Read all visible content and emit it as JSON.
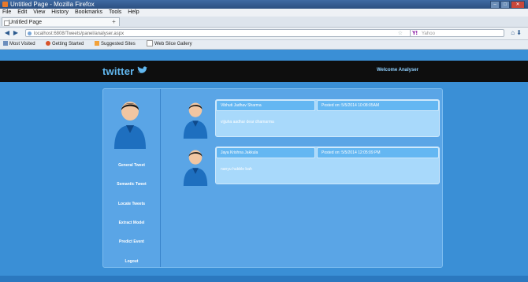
{
  "browser": {
    "window_title": "Untitled Page - Mozilla Firefox",
    "menu": [
      "File",
      "Edit",
      "View",
      "History",
      "Bookmarks",
      "Tools",
      "Help"
    ],
    "tab_title": "Untitled Page",
    "new_tab": "+",
    "url": "localhost:6808/Tweets/panel/analyser.aspx",
    "search_placeholder": "Yahoo",
    "bookmarks": [
      "Most Visited",
      "Getting Started",
      "Suggested Sites",
      "Web Slice Gallery"
    ]
  },
  "page": {
    "logo_text": "twitter",
    "welcome": "Welcome Analyser",
    "sidebar": [
      "General Tweet",
      "Semantic Tweet",
      "Locate Tweets",
      "Extract Model",
      "Predict Event",
      "Logout"
    ],
    "posts": [
      {
        "author": "Vibhuti Jadhav Sharma",
        "posted_on": "Posted on:  5/5/2014  10:08:05AM",
        "text": "vijjuha aadhar dear dhamarma"
      },
      {
        "author": "Jaya Krishna Jakkula",
        "posted_on": "Posted on:  5/5/2014  12:05:09 PM",
        "text": "nanyu hubble bah"
      }
    ]
  },
  "colors": {
    "page_bg": "#3a8fd6",
    "topbar": "#0e0e0e",
    "logo": "#62b8f0",
    "card": "#a8d9fb",
    "card_header": "#64b7f2"
  },
  "icons": {
    "bird": "twitter-bird-icon",
    "avatar": "user-avatar-icon"
  }
}
